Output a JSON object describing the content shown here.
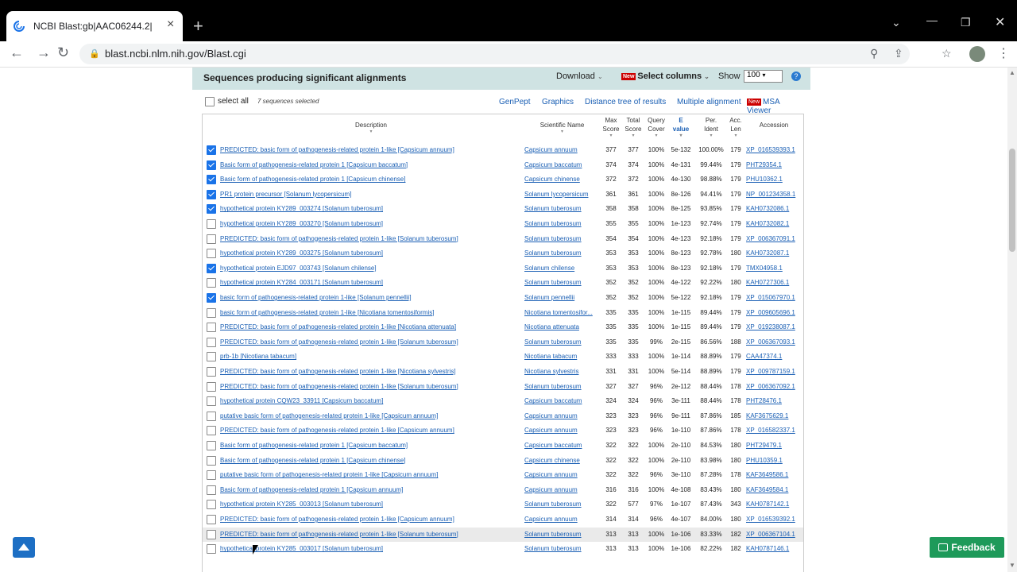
{
  "browser": {
    "tab_title": "NCBI Blast:gb|AAC06244.2|",
    "new_tab": "+",
    "url": "blast.ncbi.nlm.nih.gov/Blast.cgi"
  },
  "header": {
    "title": "Sequences producing significant alignments",
    "download": "Download",
    "select_columns": "Select columns",
    "show": "Show",
    "show_value": "100",
    "new_badge": "New",
    "help": "?"
  },
  "selection": {
    "select_all": "select all",
    "count_text": "7 sequences selected",
    "links": [
      "GenPept",
      "Graphics",
      "Distance tree of results",
      "Multiple alignment",
      "MSA Viewer"
    ]
  },
  "columns": {
    "description": "Description",
    "scientific_name": "Scientific Name",
    "max_score": [
      "Max",
      "Score"
    ],
    "total_score": [
      "Total",
      "Score"
    ],
    "query_cover": [
      "Query",
      "Cover"
    ],
    "e_value": [
      "E",
      "value"
    ],
    "per_ident": [
      "Per.",
      "Ident"
    ],
    "acc_len": [
      "Acc.",
      "Len"
    ],
    "accession": "Accession"
  },
  "rows": [
    {
      "checked": true,
      "desc": "PREDICTED: basic form of pathogenesis-related protein 1-like [Capsicum annuum]",
      "sci": "Capsicum annuum",
      "max": "377",
      "total": "377",
      "cover": "100%",
      "e": "5e-132",
      "ident": "100.00%",
      "len": "179",
      "acc": "XP_016539393.1"
    },
    {
      "checked": true,
      "desc": "Basic form of pathogenesis-related protein 1 [Capsicum baccatum]",
      "sci": "Capsicum baccatum",
      "max": "374",
      "total": "374",
      "cover": "100%",
      "e": "4e-131",
      "ident": "99.44%",
      "len": "179",
      "acc": "PHT29354.1"
    },
    {
      "checked": true,
      "desc": "Basic form of pathogenesis-related protein 1 [Capsicum chinense]",
      "sci": "Capsicum chinense",
      "max": "372",
      "total": "372",
      "cover": "100%",
      "e": "4e-130",
      "ident": "98.88%",
      "len": "179",
      "acc": "PHU10362.1"
    },
    {
      "checked": true,
      "desc": "PR1 protein precursor [Solanum lycopersicum]",
      "sci": "Solanum lycopersicum",
      "max": "361",
      "total": "361",
      "cover": "100%",
      "e": "8e-126",
      "ident": "94.41%",
      "len": "179",
      "acc": "NP_001234358.1"
    },
    {
      "checked": true,
      "desc": "hypothetical protein KY289_003274 [Solanum tuberosum]",
      "sci": "Solanum tuberosum",
      "max": "358",
      "total": "358",
      "cover": "100%",
      "e": "8e-125",
      "ident": "93.85%",
      "len": "179",
      "acc": "KAH0732086.1"
    },
    {
      "checked": false,
      "desc": "hypothetical protein KY289_003270 [Solanum tuberosum]",
      "sci": "Solanum tuberosum",
      "max": "355",
      "total": "355",
      "cover": "100%",
      "e": "1e-123",
      "ident": "92.74%",
      "len": "179",
      "acc": "KAH0732082.1"
    },
    {
      "checked": false,
      "desc": "PREDICTED: basic form of pathogenesis-related protein 1-like [Solanum tuberosum]",
      "sci": "Solanum tuberosum",
      "max": "354",
      "total": "354",
      "cover": "100%",
      "e": "4e-123",
      "ident": "92.18%",
      "len": "179",
      "acc": "XP_006367091.1"
    },
    {
      "checked": false,
      "desc": "hypothetical protein KY289_003275 [Solanum tuberosum]",
      "sci": "Solanum tuberosum",
      "max": "353",
      "total": "353",
      "cover": "100%",
      "e": "8e-123",
      "ident": "92.78%",
      "len": "180",
      "acc": "KAH0732087.1"
    },
    {
      "checked": true,
      "desc": "hypothetical protein EJD97_003743 [Solanum chilense]",
      "sci": "Solanum chilense",
      "max": "353",
      "total": "353",
      "cover": "100%",
      "e": "8e-123",
      "ident": "92.18%",
      "len": "179",
      "acc": "TMX04958.1"
    },
    {
      "checked": false,
      "desc": "hypothetical protein KY284_003171 [Solanum tuberosum]",
      "sci": "Solanum tuberosum",
      "max": "352",
      "total": "352",
      "cover": "100%",
      "e": "4e-122",
      "ident": "92.22%",
      "len": "180",
      "acc": "KAH0727306.1"
    },
    {
      "checked": true,
      "desc": "basic form of pathogenesis-related protein 1-like [Solanum pennellii]",
      "sci": "Solanum pennellii",
      "max": "352",
      "total": "352",
      "cover": "100%",
      "e": "5e-122",
      "ident": "92.18%",
      "len": "179",
      "acc": "XP_015067970.1"
    },
    {
      "checked": false,
      "desc": "basic form of pathogenesis-related protein 1-like [Nicotiana tomentosiformis]",
      "sci": "Nicotiana tomentosifor...",
      "max": "335",
      "total": "335",
      "cover": "100%",
      "e": "1e-115",
      "ident": "89.44%",
      "len": "179",
      "acc": "XP_009605696.1"
    },
    {
      "checked": false,
      "desc": "PREDICTED: basic form of pathogenesis-related protein 1-like [Nicotiana attenuata]",
      "sci": "Nicotiana attenuata",
      "max": "335",
      "total": "335",
      "cover": "100%",
      "e": "1e-115",
      "ident": "89.44%",
      "len": "179",
      "acc": "XP_019238087.1"
    },
    {
      "checked": false,
      "desc": "PREDICTED: basic form of pathogenesis-related protein 1-like [Solanum tuberosum]",
      "sci": "Solanum tuberosum",
      "max": "335",
      "total": "335",
      "cover": "99%",
      "e": "2e-115",
      "ident": "86.56%",
      "len": "188",
      "acc": "XP_006367093.1"
    },
    {
      "checked": false,
      "desc": "prb-1b [Nicotiana tabacum]",
      "sci": "Nicotiana tabacum",
      "max": "333",
      "total": "333",
      "cover": "100%",
      "e": "1e-114",
      "ident": "88.89%",
      "len": "179",
      "acc": "CAA47374.1"
    },
    {
      "checked": false,
      "desc": "PREDICTED: basic form of pathogenesis-related protein 1-like [Nicotiana sylvestris]",
      "sci": "Nicotiana sylvestris",
      "max": "331",
      "total": "331",
      "cover": "100%",
      "e": "5e-114",
      "ident": "88.89%",
      "len": "179",
      "acc": "XP_009787159.1"
    },
    {
      "checked": false,
      "desc": "PREDICTED: basic form of pathogenesis-related protein 1-like [Solanum tuberosum]",
      "sci": "Solanum tuberosum",
      "max": "327",
      "total": "327",
      "cover": "96%",
      "e": "2e-112",
      "ident": "88.44%",
      "len": "178",
      "acc": "XP_006367092.1"
    },
    {
      "checked": false,
      "desc": "hypothetical protein CQW23_33911 [Capsicum baccatum]",
      "sci": "Capsicum baccatum",
      "max": "324",
      "total": "324",
      "cover": "96%",
      "e": "3e-111",
      "ident": "88.44%",
      "len": "178",
      "acc": "PHT28476.1"
    },
    {
      "checked": false,
      "desc": "putative basic form of pathogenesis-related protein 1-like [Capsicum annuum]",
      "sci": "Capsicum annuum",
      "max": "323",
      "total": "323",
      "cover": "96%",
      "e": "9e-111",
      "ident": "87.86%",
      "len": "185",
      "acc": "KAF3675629.1"
    },
    {
      "checked": false,
      "desc": "PREDICTED: basic form of pathogenesis-related protein 1-like [Capsicum annuum]",
      "sci": "Capsicum annuum",
      "max": "323",
      "total": "323",
      "cover": "96%",
      "e": "1e-110",
      "ident": "87.86%",
      "len": "178",
      "acc": "XP_016582337.1"
    },
    {
      "checked": false,
      "desc": "Basic form of pathogenesis-related protein 1 [Capsicum baccatum]",
      "sci": "Capsicum baccatum",
      "max": "322",
      "total": "322",
      "cover": "100%",
      "e": "2e-110",
      "ident": "84.53%",
      "len": "180",
      "acc": "PHT29479.1"
    },
    {
      "checked": false,
      "desc": "Basic form of pathogenesis-related protein 1 [Capsicum chinense]",
      "sci": "Capsicum chinense",
      "max": "322",
      "total": "322",
      "cover": "100%",
      "e": "2e-110",
      "ident": "83.98%",
      "len": "180",
      "acc": "PHU10359.1"
    },
    {
      "checked": false,
      "desc": "putative basic form of pathogenesis-related protein 1-like [Capsicum annuum]",
      "sci": "Capsicum annuum",
      "max": "322",
      "total": "322",
      "cover": "96%",
      "e": "3e-110",
      "ident": "87.28%",
      "len": "178",
      "acc": "KAF3649586.1"
    },
    {
      "checked": false,
      "desc": "Basic form of pathogenesis-related protein 1 [Capsicum annuum]",
      "sci": "Capsicum annuum",
      "max": "316",
      "total": "316",
      "cover": "100%",
      "e": "4e-108",
      "ident": "83.43%",
      "len": "180",
      "acc": "KAF3649584.1"
    },
    {
      "checked": false,
      "desc": "hypothetical protein KY285_003013 [Solanum tuberosum]",
      "sci": "Solanum tuberosum",
      "max": "322",
      "total": "577",
      "cover": "97%",
      "e": "1e-107",
      "ident": "87.43%",
      "len": "343",
      "acc": "KAH0787142.1"
    },
    {
      "checked": false,
      "desc": "PREDICTED: basic form of pathogenesis-related protein 1-like [Capsicum annuum]",
      "sci": "Capsicum annuum",
      "max": "314",
      "total": "314",
      "cover": "96%",
      "e": "4e-107",
      "ident": "84.00%",
      "len": "180",
      "acc": "XP_016539392.1"
    },
    {
      "checked": false,
      "desc": "PREDICTED: basic form of pathogenesis-related protein 1-like [Solanum tuberosum]",
      "sci": "Solanum tuberosum",
      "max": "313",
      "total": "313",
      "cover": "100%",
      "e": "1e-106",
      "ident": "83.33%",
      "len": "182",
      "acc": "XP_006367104.1",
      "highlight": true
    },
    {
      "checked": false,
      "desc": "hypothetical protein KY285_003017 [Solanum tuberosum]",
      "sci": "Solanum tuberosum",
      "max": "313",
      "total": "313",
      "cover": "100%",
      "e": "1e-106",
      "ident": "82.22%",
      "len": "182",
      "acc": "KAH0787146.1"
    }
  ],
  "feedback": "Feedback",
  "colors": {
    "header_bar": "#cfe3e3",
    "link": "#1a5fb4",
    "feedback": "#1e9a5a",
    "check": "#1a73e8"
  }
}
